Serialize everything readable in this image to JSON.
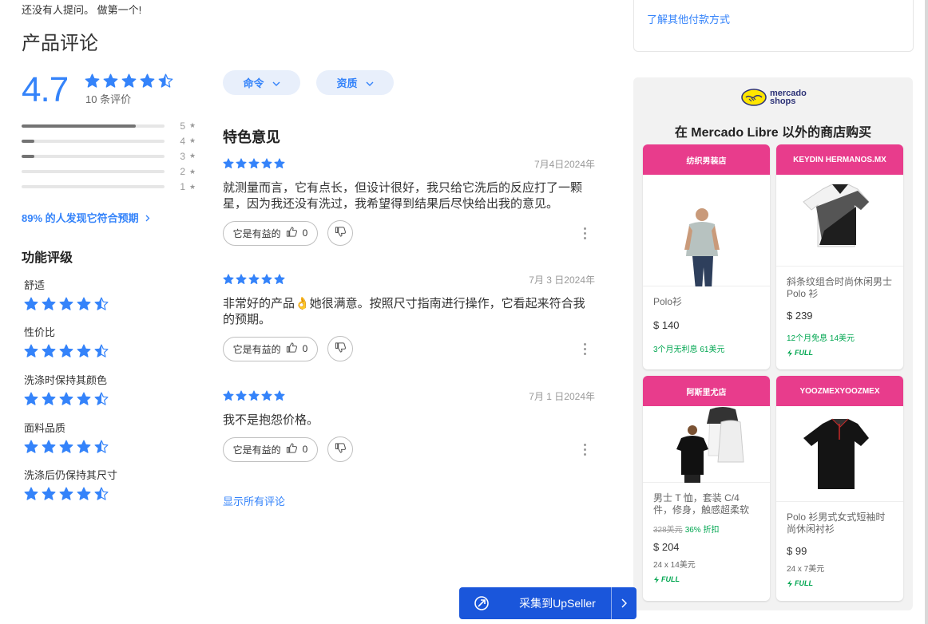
{
  "questions": {
    "empty_text": "还没有人提问。 做第一个!"
  },
  "reviews": {
    "title": "产品评论",
    "average": "4.7",
    "average_value": 4.7,
    "count_label": "10 条评价",
    "distribution": [
      {
        "stars": "5",
        "fraction": 0.8
      },
      {
        "stars": "4",
        "fraction": 0.09
      },
      {
        "stars": "3",
        "fraction": 0.09
      },
      {
        "stars": "2",
        "fraction": 0
      },
      {
        "stars": "1",
        "fraction": 0
      }
    ],
    "helpful_link": "89% 的人发现它符合预期",
    "features_title": "功能评级",
    "features": [
      {
        "label": "舒适",
        "rating": 4.5
      },
      {
        "label": "性价比",
        "rating": 4.5
      },
      {
        "label": "洗涤时保持其颜色",
        "rating": 4.5
      },
      {
        "label": "面料品质",
        "rating": 4.5
      },
      {
        "label": "洗涤后仍保持其尺寸",
        "rating": 4.5
      }
    ],
    "filters": {
      "order": "命令",
      "quality": "资质"
    },
    "featured_title": "特色意见",
    "items": [
      {
        "date": "7月4日2024年",
        "rating": 5,
        "text": "就测量而言，它有点长，但设计很好，我只给它洗后的反应打了一颗星，因为我还没有洗过，我希望得到结果后尽快给出我的意见。",
        "helpful_label": "它是有益的",
        "helpful_count": "0"
      },
      {
        "date": "7月 3 日2024年",
        "rating": 5,
        "text": "非常好的产品👌她很满意。按照尺寸指南进行操作，它看起来符合我的预期。",
        "helpful_label": "它是有益的",
        "helpful_count": "0"
      },
      {
        "date": "7月 1 日2024年",
        "rating": 5,
        "text": "我不是抱怨价格。",
        "helpful_label": "它是有益的",
        "helpful_count": "0"
      }
    ],
    "show_all": "显示所有评论"
  },
  "payment": {
    "link": "了解其他付款方式"
  },
  "shops": {
    "logo_line1": "mercado",
    "logo_line2": "shops",
    "heading": "在 Mercado Libre 以外的商店购买",
    "products": [
      {
        "store": "纺织男装店",
        "name": "Polo衫",
        "price": "$ 140",
        "installments": "3个月无利息 61美元",
        "full": ""
      },
      {
        "store": "KEYDIN HERMANOS.MX",
        "name": "斜条纹组合时尚休闲男士 Polo 衫",
        "price": "$ 239",
        "installments": "12个月免息 14美元",
        "full": "FULL"
      },
      {
        "store": "阿斯里尤店",
        "name": "男士 T 恤，套装 C/4 件，修身，触感超柔软",
        "old_price": "328美元",
        "discount": "36% 折扣",
        "price": "$ 204",
        "installments": "24 x 14美元",
        "full": "FULL"
      },
      {
        "store": "YOOZMEXYOOZMEX",
        "name": "Polo 衫男式女式短袖时尚休闲衬衫",
        "price": "$ 99",
        "installments": "24 x 7美元",
        "full": "FULL"
      }
    ]
  },
  "upseller": {
    "label": "采集到UpSeller"
  },
  "colors": {
    "accent": "#3483fa",
    "pink": "#e83c8c",
    "green": "#00a650",
    "upseller": "#1a56db"
  }
}
